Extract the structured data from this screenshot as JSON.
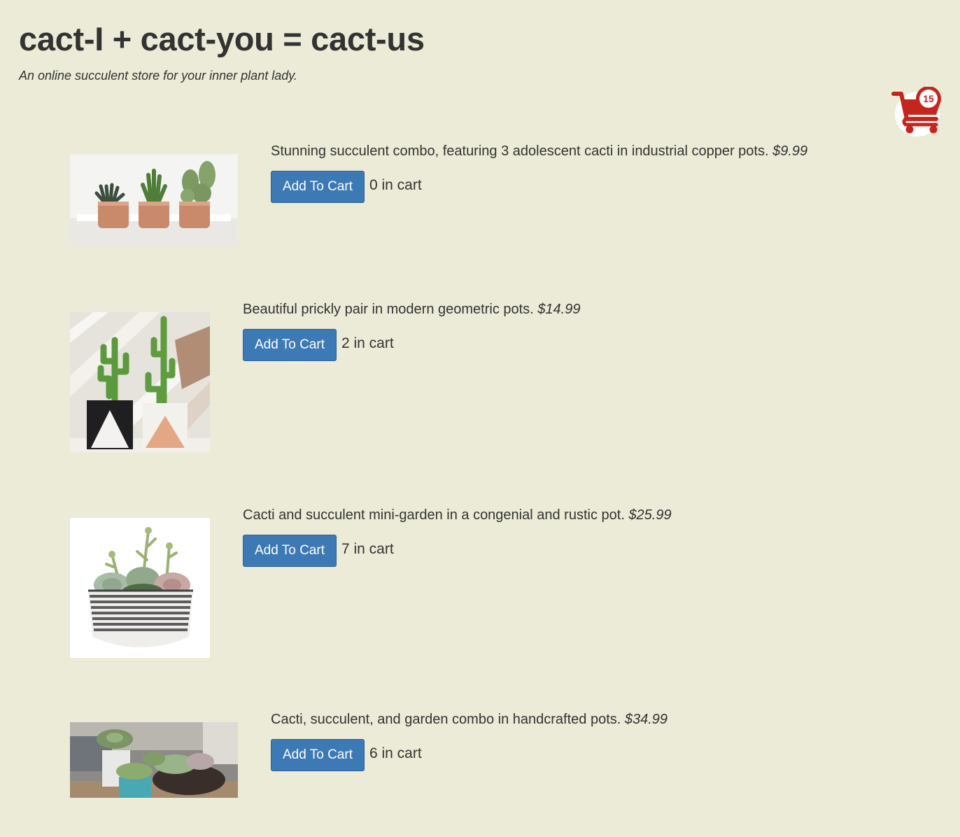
{
  "header": {
    "title": "cact-I + cact-you = cact-us",
    "tagline": "An online succulent store for your inner plant lady."
  },
  "cart": {
    "count": "15",
    "icon": "shopping-cart-icon",
    "color": "#c4261d"
  },
  "products": [
    {
      "description": "Stunning succulent combo, featuring 3 adolescent cacti in industrial copper pots.",
      "price": "$9.99",
      "button_label": "Add To Cart",
      "in_cart": "0 in cart",
      "image": "three-cacti-copper-pots-image"
    },
    {
      "description": "Beautiful prickly pair in modern geometric pots.",
      "price": "$14.99",
      "button_label": "Add To Cart",
      "in_cart": "2 in cart",
      "image": "prickly-pair-geometric-pots-image"
    },
    {
      "description": "Cacti and succulent mini-garden in a congenial and rustic pot.",
      "price": "$25.99",
      "button_label": "Add To Cart",
      "in_cart": "7 in cart",
      "image": "succulent-mini-garden-bowl-image"
    },
    {
      "description": "Cacti, succulent, and garden combo in handcrafted pots.",
      "price": "$34.99",
      "button_label": "Add To Cart",
      "in_cart": "6 in cart",
      "image": "garden-combo-handcrafted-pots-image"
    }
  ],
  "colors": {
    "background": "#ebebd7",
    "button": "#3d79b4",
    "text": "#333333"
  }
}
